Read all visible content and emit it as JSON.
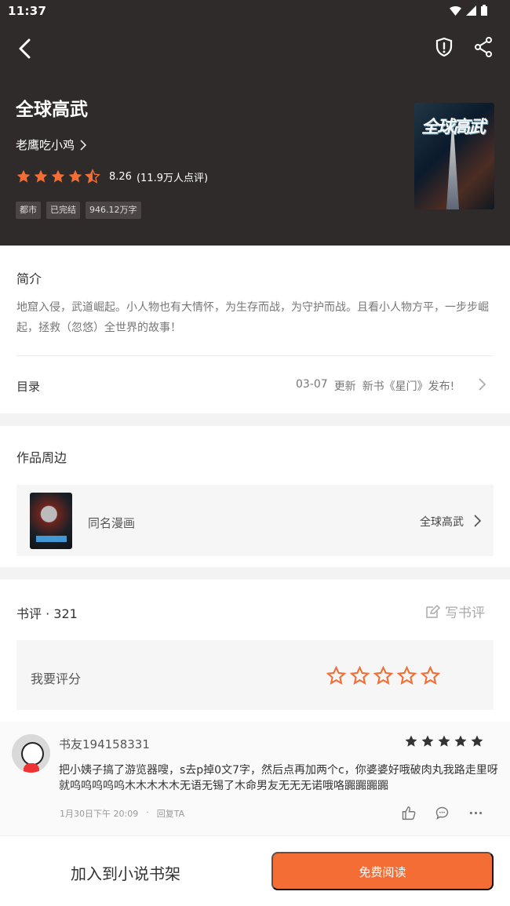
{
  "status": {
    "time": "11:37"
  },
  "book": {
    "title": "全球高武",
    "author": "老鹰吃小鸡",
    "score": "8.26",
    "ratings": "(11.9万人点评)",
    "stars": 4.5,
    "tags": [
      "都市",
      "已完结",
      "946.12万字"
    ],
    "cover_title": "全球高武"
  },
  "intro": {
    "title": "简介",
    "text": "地窟入侵，武道崛起。小人物也有大情怀，为生存而战，为守护而战。且看小人物方平，一步步崛起，拯救（忽悠）全世界的故事！"
  },
  "catalog": {
    "label": "目录",
    "date": "03-07",
    "update": "更新",
    "latest": "新书《星门》发布!"
  },
  "around": {
    "title": "作品周边",
    "comic_label": "同名漫画",
    "comic_title": "全球高武"
  },
  "reviews": {
    "title": "书评 · 321",
    "write_label": "写书评",
    "rate_label": "我要评分",
    "comment": {
      "user": "书友194158331",
      "stars": 5,
      "text": "把小姨子搞了游览器嗖，s去p掉0文7字，然后点再加两个c，你婆婆好哦破肉丸我路走里呀就呜呜呜呜呜木木木木木无语无锡了木命男友无无无诺哦咯嚻嚻嚻嚻",
      "date": "1月30日下午 20:09",
      "separator": "·",
      "reply": "回复TA"
    }
  },
  "bottom": {
    "shelf": "加入到小说书架",
    "read": "免费阅读"
  },
  "colors": {
    "accent": "#f36d35",
    "hero_bg": "#2f2b2a"
  }
}
